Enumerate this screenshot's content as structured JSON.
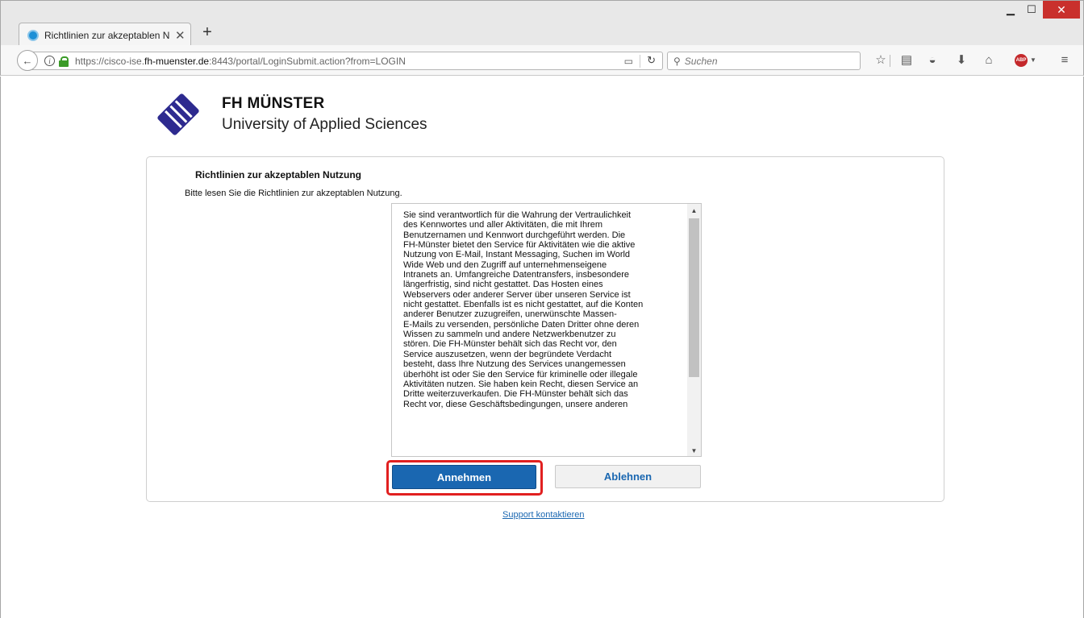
{
  "browser": {
    "tab_title": "Richtlinien zur akzeptablen N",
    "new_tab_label": "+",
    "url_prefix": "https://cisco-ise.",
    "url_domain": "fh-muenster.de",
    "url_suffix": ":8443/portal/LoginSubmit.action?from=LOGIN",
    "search_placeholder": "Suchen",
    "toolbar_icons": [
      "bookmark-star-icon",
      "reading-list-icon",
      "pocket-icon",
      "download-icon",
      "home-icon",
      "adblock-icon",
      "menu-icon"
    ],
    "abp_label": "ABP"
  },
  "brand": {
    "title": "FH MÜNSTER",
    "subtitle": "University of Applied Sciences",
    "accent_color": "#2d2a8f"
  },
  "policy": {
    "heading": "Richtlinien zur akzeptablen Nutzung",
    "intro": "Bitte lesen Sie die Richtlinien zur akzeptablen Nutzung.",
    "lines": [
      "Sie sind verantwortlich für die Wahrung der Vertraulichkeit",
      "des Kennwortes und aller Aktivitäten, die mit Ihrem",
      "Benutzernamen und Kennwort durchgeführt werden. Die",
      "FH-Münster bietet den Service für Aktivitäten wie die aktive",
      "Nutzung von E-Mail, Instant Messaging, Suchen im World",
      "Wide Web und den Zugriff auf unternehmenseigene",
      "Intranets an. Umfangreiche Datentransfers, insbesondere",
      "längerfristig, sind nicht gestattet. Das Hosten eines",
      "Webservers oder anderer Server über unseren Service ist",
      "nicht gestattet. Ebenfalls ist es nicht gestattet, auf die Konten",
      "anderer Benutzer zuzugreifen, unerwünschte Massen-",
      "E-Mails zu versenden, persönliche Daten Dritter ohne deren",
      "Wissen zu sammeln und andere Netzwerkbenutzer zu",
      "stören. Die FH-Münster behält sich das Recht vor, den",
      "Service auszusetzen, wenn der begründete Verdacht",
      "besteht, dass Ihre Nutzung des Services unangemessen",
      "überhöht ist oder Sie den Service für kriminelle oder illegale",
      "Aktivitäten nutzen. Sie haben kein Recht, diesen Service an",
      "Dritte weiterzuverkaufen. Die FH-Münster behält sich das",
      "Recht vor, diese Geschäftsbedingungen, unsere anderen"
    ],
    "accept_label": "Annehmen",
    "decline_label": "Ablehnen",
    "support_link": "Support kontaktieren"
  },
  "colors": {
    "primary_button": "#1a67b1",
    "highlight": "#e12020"
  }
}
